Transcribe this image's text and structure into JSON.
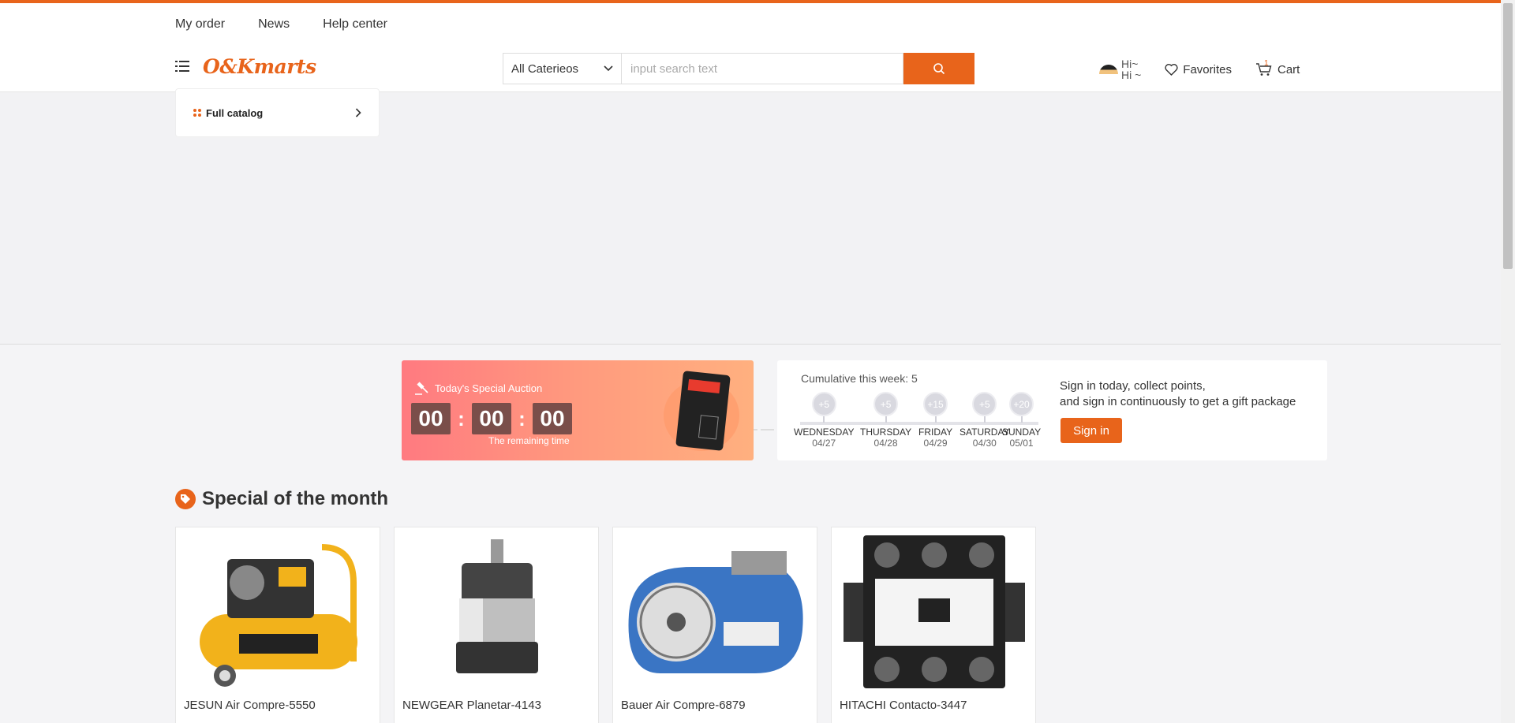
{
  "top_links": [
    "My order",
    "News",
    "Help center"
  ],
  "brand": {
    "logo_text": "O&Kmarts",
    "accent": "#e8641b"
  },
  "search": {
    "category": "All Caterieos",
    "placeholder": "input search text"
  },
  "user": {
    "greeting_1": "Hi~",
    "greeting_2": "Hi ~"
  },
  "nav": {
    "favorites": "Favorites",
    "cart": "Cart",
    "cart_count": "1"
  },
  "catalog": {
    "label": "Full catalog"
  },
  "auction": {
    "title": "Today's Special Auction",
    "hours": "00",
    "minutes": "00",
    "seconds": "00",
    "remaining": "The remaining time"
  },
  "checkin": {
    "cumulative": "Cumulative this week: 5",
    "days": [
      {
        "points": "+5",
        "name": "WEDNESDAY",
        "date": "04/27"
      },
      {
        "points": "+5",
        "name": "THURSDAY",
        "date": "04/28"
      },
      {
        "points": "+15",
        "name": "FRIDAY",
        "date": "04/29"
      },
      {
        "points": "+5",
        "name": "SATURDAY",
        "date": "04/30"
      },
      {
        "points": "+20",
        "name": "SUNDAY",
        "date": "05/01"
      }
    ],
    "message_1": "Sign in today, collect points,",
    "message_2": "and sign in continuously to get a gift package",
    "button": "Sign in"
  },
  "special": {
    "title": "Special of the month",
    "products": [
      {
        "name": "JESUN Air Compre-5550",
        "icon": "air-compressor-image"
      },
      {
        "name": "NEWGEAR Planetar-4143",
        "icon": "planetary-gearbox-image"
      },
      {
        "name": "Bauer Air Compre-6879",
        "icon": "bauer-compressor-image"
      },
      {
        "name": "HITACHI Contacto-3447",
        "icon": "contactor-image"
      }
    ]
  }
}
